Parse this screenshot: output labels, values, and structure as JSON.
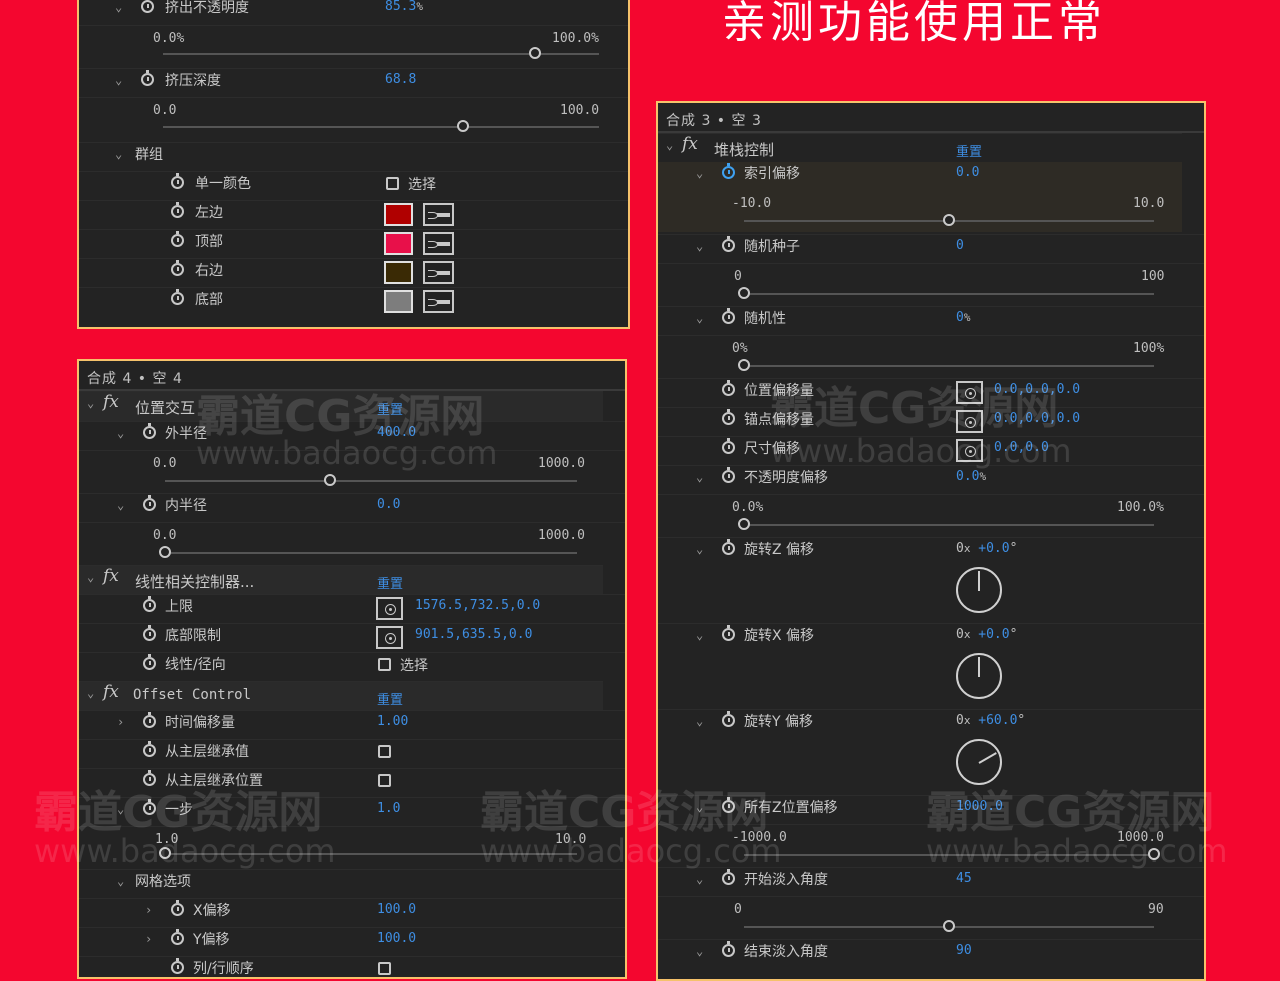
{
  "heading": "亲测功能使用正常",
  "panel1": {
    "opacity": {
      "label": "挤出不透明度",
      "value": "85.3",
      "unit": "%",
      "min": "0.0%",
      "max": "100.0%",
      "level": 0.853
    },
    "depth": {
      "label": "挤压深度",
      "value": "68.8",
      "min": "0.0",
      "max": "100.0",
      "level": 0.688
    },
    "group_label": "群组",
    "single_color": {
      "label": "单一颜色",
      "check_label": "选择"
    },
    "colors": [
      {
        "label": "左边",
        "color": "#b00000"
      },
      {
        "label": "顶部",
        "color": "#e8104a"
      },
      {
        "label": "右边",
        "color": "#3a2a05"
      },
      {
        "label": "底部",
        "color": "#7d7d7d"
      }
    ]
  },
  "panel2": {
    "comp": "合成 4 • 空 4",
    "fx1": {
      "name": "位置交互",
      "reset": "重置",
      "outer": {
        "label": "外半径",
        "value": "400.0",
        "min": "0.0",
        "max": "1000.0",
        "level": 0.4
      },
      "inner": {
        "label": "内半径",
        "value": "0.0",
        "min": "0.0",
        "max": "1000.0",
        "level": 0.0
      }
    },
    "fx2": {
      "name": "线性相关控制器...",
      "reset": "重置",
      "upper": {
        "label": "上限",
        "value": "1576.5,732.5,0.0"
      },
      "bottom": {
        "label": "底部限制",
        "value": "901.5,635.5,0.0"
      },
      "linear": {
        "label": "线性/径向",
        "check_label": "选择"
      }
    },
    "fx3": {
      "name": "Offset Control",
      "reset": "重置",
      "time": {
        "label": "时间偏移量",
        "value": "1.00"
      },
      "inherit_val": {
        "label": "从主层继承值"
      },
      "inherit_pos": {
        "label": "从主层继承位置"
      },
      "step": {
        "label": "一步",
        "value": "1.0",
        "min": "1.0",
        "max": "10.0",
        "level": 0.0
      },
      "grid": {
        "label": "网格选项"
      },
      "xoff": {
        "label": "X偏移",
        "value": "100.0"
      },
      "yoff": {
        "label": "Y偏移",
        "value": "100.0"
      },
      "order": {
        "label": "列/行顺序"
      }
    }
  },
  "panel3": {
    "comp": "合成 3 • 空 3",
    "fx": {
      "name": "堆栈控制",
      "reset": "重置"
    },
    "index": {
      "label": "索引偏移",
      "value": "0.0",
      "min": "-10.0",
      "max": "10.0",
      "level": 0.5
    },
    "seed": {
      "label": "随机种子",
      "value": "0",
      "min": "0",
      "max": "100",
      "level": 0.0
    },
    "random": {
      "label": "随机性",
      "value": "0",
      "unit": "%",
      "min": "0%",
      "max": "100%",
      "level": 0.0
    },
    "pos": {
      "label": "位置偏移量",
      "value": "0.0,0.0,0.0"
    },
    "anchor": {
      "label": "锚点偏移量",
      "value": "0.0,0.0,0.0"
    },
    "size": {
      "label": "尺寸偏移",
      "value": "0.0,0.0"
    },
    "opacity": {
      "label": "不透明度偏移",
      "value": "0.0",
      "unit": "%",
      "min": "0.0%",
      "max": "100.0%",
      "level": 0.0
    },
    "rotz": {
      "label": "旋转Z 偏移",
      "turns": "0",
      "x": "x",
      "deg": "+0.0",
      "degsym": "°",
      "angle": 0
    },
    "rotx": {
      "label": "旋转X 偏移",
      "turns": "0",
      "x": "x",
      "deg": "+0.0",
      "degsym": "°",
      "angle": 0
    },
    "roty": {
      "label": "旋转Y 偏移",
      "turns": "0",
      "x": "x",
      "deg": "+60.0",
      "degsym": "°",
      "angle": 60
    },
    "allz": {
      "label": "所有Z位置偏移",
      "value": "1000.0",
      "min": "-1000.0",
      "max": "1000.0",
      "level": 1.0
    },
    "fadein": {
      "label": "开始淡入角度",
      "value": "45",
      "min": "0",
      "max": "90",
      "level": 0.5
    },
    "fadeout": {
      "label": "结束淡入角度",
      "value": "90"
    }
  },
  "watermark": {
    "brand": "霸道CG资源网",
    "url": "www.badaocg.com"
  }
}
